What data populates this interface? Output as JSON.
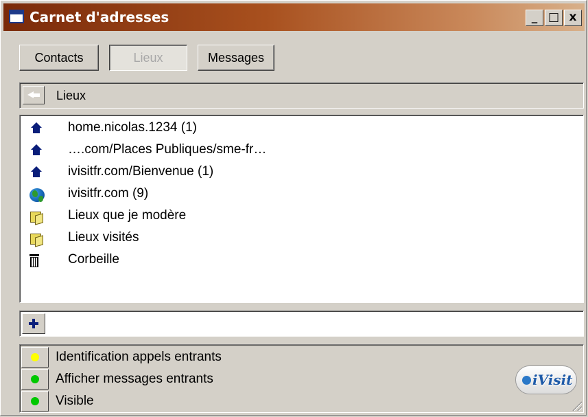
{
  "window": {
    "title": "Carnet d'adresses",
    "controls": {
      "minimize": "_",
      "maximize": "□",
      "close": "x"
    }
  },
  "tabs": [
    {
      "label": "Contacts",
      "active": false
    },
    {
      "label": "Lieux",
      "active": true
    },
    {
      "label": "Messages",
      "active": false
    }
  ],
  "breadcrumb": {
    "label": "Lieux",
    "back_icon": "back-arrow-icon"
  },
  "places": [
    {
      "label": "home.nicolas.1234 (1)",
      "icon": "house-icon"
    },
    {
      "label": "….com/Places Publiques/sme-fr…",
      "icon": "house-icon"
    },
    {
      "label": "ivisitfr.com/Bienvenue (1)",
      "icon": "house-icon"
    },
    {
      "label": "ivisitfr.com (9)",
      "icon": "globe-icon"
    },
    {
      "label": "Lieux que je modère",
      "icon": "folder-icon"
    },
    {
      "label": "Lieux visités",
      "icon": "folder-icon"
    },
    {
      "label": "Corbeille",
      "icon": "trash-icon"
    }
  ],
  "add_bar": {
    "value": "",
    "icon": "plus-icon"
  },
  "status": [
    {
      "label": "Identification appels entrants",
      "color": "#ffff00"
    },
    {
      "label": "Afficher messages entrants",
      "color": "#00c800"
    },
    {
      "label": "Visible",
      "color": "#00c800"
    }
  ],
  "logo": {
    "text": "iVisit"
  }
}
